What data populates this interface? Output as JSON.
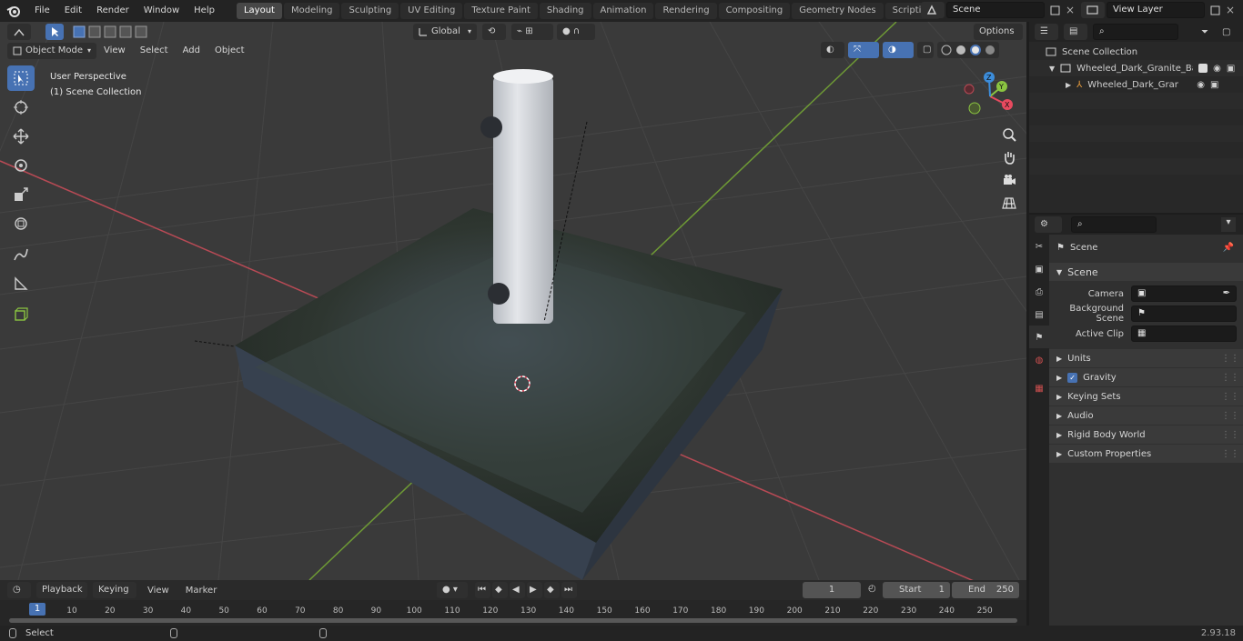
{
  "menu": {
    "file": "File",
    "edit": "Edit",
    "render": "Render",
    "window": "Window",
    "help": "Help"
  },
  "workspaces": [
    "Layout",
    "Modeling",
    "Sculpting",
    "UV Editing",
    "Texture Paint",
    "Shading",
    "Animation",
    "Rendering",
    "Compositing",
    "Geometry Nodes",
    "Scripting"
  ],
  "scene_name": "Scene",
  "view_layer": "View Layer",
  "viewport": {
    "mode": "Object Mode",
    "menus": [
      "View",
      "Select",
      "Add",
      "Object"
    ],
    "transform_orientation": "Global",
    "options_label": "Options",
    "overlay_line1": "User Perspective",
    "overlay_line2": "(1) Scene Collection",
    "gizmo": {
      "x": "X",
      "y": "Y",
      "z": "Z"
    }
  },
  "outliner": {
    "root": "Scene Collection",
    "items": [
      {
        "name": "Wheeled_Dark_Granite_Base_"
      },
      {
        "name": "Wheeled_Dark_Granite_E"
      }
    ]
  },
  "properties": {
    "context": "Scene",
    "section": "Scene",
    "fields": [
      {
        "label": "Camera",
        "value": ""
      },
      {
        "label": "Background Scene",
        "value": ""
      },
      {
        "label": "Active Clip",
        "value": ""
      }
    ],
    "panels": [
      "Units",
      "Gravity",
      "Keying Sets",
      "Audio",
      "Rigid Body World",
      "Custom Properties"
    ]
  },
  "timeline": {
    "menus": [
      "Playback",
      "Keying",
      "View",
      "Marker"
    ],
    "current_frame": "1",
    "start_label": "Start",
    "start": "1",
    "end_label": "End",
    "end": "250",
    "ticks": [
      "10",
      "20",
      "30",
      "40",
      "50",
      "60",
      "70",
      "80",
      "90",
      "100",
      "110",
      "120",
      "130",
      "140",
      "150",
      "160",
      "170",
      "180",
      "190",
      "200",
      "210",
      "220",
      "230",
      "240",
      "250"
    ],
    "cursor_label": "1"
  },
  "status": {
    "left": "Select",
    "version": "2.93.18"
  },
  "colors": {
    "accent": "#4772b3",
    "x_axis": "#e84a5f",
    "y_axis": "#8ac441",
    "z_axis": "#3c8ddb",
    "viewport_bg": "#3a3a3a"
  }
}
